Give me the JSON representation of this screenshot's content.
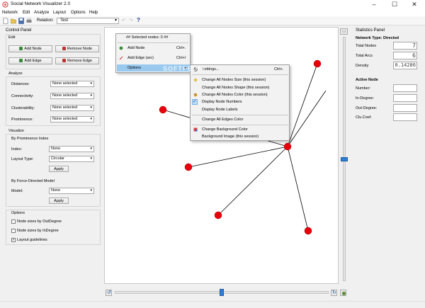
{
  "window": {
    "title": "Social Network Visualizer 2.0",
    "icons": [
      "app-icon",
      "minimize-icon",
      "maximize-icon",
      "close-icon"
    ]
  },
  "menubar": {
    "items": [
      "Network",
      "Edit",
      "Analyze",
      "Layout",
      "Options",
      "Help"
    ]
  },
  "toolbar": {
    "relation_label": "Relation:",
    "relation_value": "Test",
    "icons": [
      "new-file-icon",
      "open-folder-icon",
      "save-icon",
      "print-icon",
      "back-arrow-icon",
      "forward-arrow-icon",
      "help-icon"
    ]
  },
  "control_panel": {
    "title": "Control Panel",
    "edit": {
      "label": "Edit",
      "add_node": "Add Node",
      "remove_node": "Remove Node",
      "add_edge": "Add Edge",
      "remove_edge": "Remove Edge"
    },
    "analyze": {
      "label": "Analyze",
      "rows": [
        {
          "label": "Distances:",
          "value": "None selected"
        },
        {
          "label": "Connectivity:",
          "value": "None selected"
        },
        {
          "label": "Clusterability:",
          "value": "None selected"
        },
        {
          "label": "Prominence:",
          "value": "None selected"
        }
      ]
    },
    "visualize": {
      "label": "Visualize",
      "prominence": {
        "label": "By Prominence Index",
        "index_label": "Index:",
        "index_value": "None",
        "layout_label": "Layout Type:",
        "layout_value": "Circular",
        "apply": "Apply"
      },
      "force": {
        "label": "By Force-Directed Model",
        "model_label": "Model:",
        "model_value": "None",
        "apply": "Apply"
      }
    },
    "options": {
      "label": "Options",
      "items": [
        {
          "label": "Node sizes by OutDegree",
          "checked": false
        },
        {
          "label": "Node sizes by InDegree",
          "checked": false
        },
        {
          "label": "Layout guidelines",
          "checked": true
        }
      ]
    }
  },
  "context_menu": {
    "header": "## Selected nodes: 0 ##",
    "items": [
      {
        "label": "Add Node",
        "shortcut": "Ctrl+.",
        "icon": "add-node-icon"
      },
      {
        "label": "Add Edge (arc)",
        "shortcut": "Ctrl+/",
        "icon": "add-edge-icon"
      },
      {
        "label": "Options",
        "shortcut": "",
        "icon": "",
        "submenu_arrow": "▸"
      }
    ]
  },
  "options_submenu": {
    "items": [
      {
        "label": "Settings...",
        "shortcut": "Ctrl+.",
        "icon": "gear-icon"
      },
      {
        "label": "Change All Nodes Size (this session)",
        "icon": "resize-icon"
      },
      {
        "label": "Change All Nodes Shape (this session)",
        "icon": ""
      },
      {
        "label": "Change All Nodes Color (this session)",
        "icon": "palette-icon"
      },
      {
        "label": "Display Node Numbers",
        "icon": "checkmark-icon",
        "checked": true
      },
      {
        "label": "Display Node Labels",
        "icon": ""
      },
      {
        "label": "Change All Edges Color",
        "icon": ""
      },
      {
        "label": "Change Background Color",
        "icon": "color-picker-icon"
      },
      {
        "label": "Background Image (this session)",
        "icon": ""
      }
    ]
  },
  "statistics": {
    "title": "Statistics Panel",
    "network_type": "Network Type: Directed",
    "total_nodes_label": "Total Nodes",
    "total_nodes": "7",
    "total_arcs_label": "Total Arcs",
    "total_arcs": "6",
    "density_label": "Density",
    "density": "0.14286",
    "active_node": {
      "title": "Active Node",
      "number_label": "Number:",
      "in_degree_label": "In-Degree:",
      "out_degree_label": "Out-Degree:",
      "clu_coef_label": "Clu.Coef."
    }
  },
  "zoom": {
    "vertical_level": 0.5,
    "horizontal_level": 0.5,
    "icons": [
      "zoom-in-icon",
      "rotate-left-icon",
      "rotate-right-icon",
      "reset-view-icon"
    ]
  },
  "colors": {
    "node": "#e8000b",
    "edge": "#000000",
    "menu_highlight": "#99c9ef",
    "slider_handle": "#2d7fd3"
  },
  "watermark": "SOFTPEDIA"
}
